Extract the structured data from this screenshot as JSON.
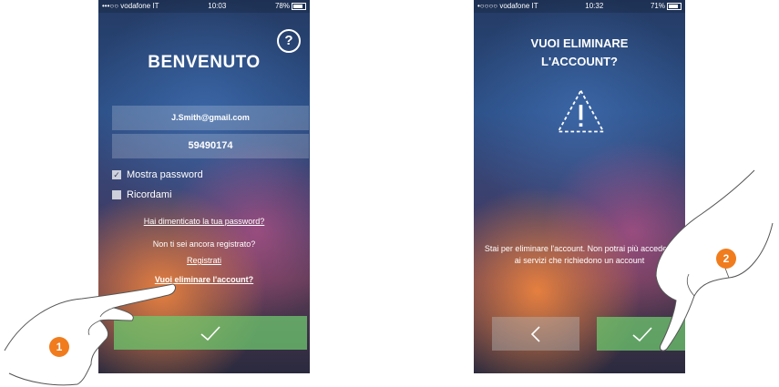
{
  "screen1": {
    "status": {
      "carrier": "•••○○ vodafone IT",
      "time": "10:03",
      "battery": "78%"
    },
    "help_label": "?",
    "title": "BENVENUTO",
    "email": "J.Smith@gmail.com",
    "password": "59490174",
    "show_password_label": "Mostra password",
    "show_password_checked": true,
    "remember_label": "Ricordami",
    "forgot_link": "Hai dimenticato la tua password?",
    "not_registered": "Non ti sei ancora registrato?",
    "register_link": "Registrati",
    "delete_link": "Vuoi eliminare l'account?",
    "confirm_icon": "check-icon"
  },
  "screen2": {
    "status": {
      "carrier": "•○○○○ vodafone IT",
      "time": "10:32",
      "battery": "71%"
    },
    "title_line1": "VUOI ELIMINARE",
    "title_line2": "L'ACCOUNT?",
    "warning_icon": "warning-icon",
    "message": "Stai per eliminare l'account. Non potrai più accedere ai servizi che richiedono un account",
    "back_icon": "chevron-left-icon",
    "confirm_icon": "check-icon"
  },
  "steps": {
    "one": "1",
    "two": "2"
  },
  "colors": {
    "step_badge": "#f07c1e",
    "confirm_button": "#6ec86e"
  }
}
